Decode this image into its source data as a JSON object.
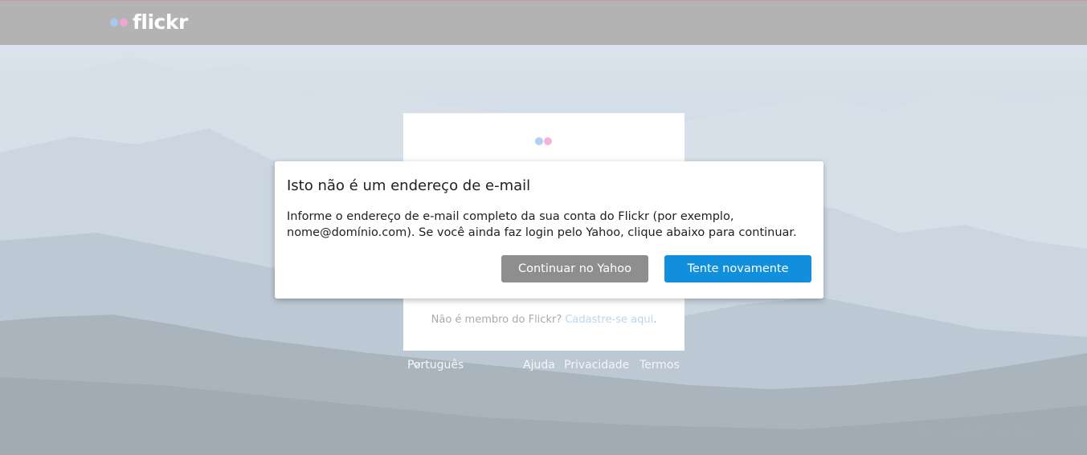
{
  "header": {
    "logo_text": "flickr",
    "logo_icon": "flickr-dots-icon"
  },
  "card": {
    "logo_icon": "flickr-dots-icon",
    "signup_prompt": "Não é membro do Flickr?",
    "signup_link": "Cadastre-se aqui",
    "signup_suffix": "."
  },
  "footer": {
    "language": "Português",
    "language_icon": "chevron-down-icon",
    "links": [
      "Ajuda",
      "Privacidade",
      "Termos"
    ]
  },
  "photo_credit": "033120190455 por Henry , CC BY",
  "dialog": {
    "title": "Isto não é um endereço de e-mail",
    "message": "Informe o endereço de e-mail completo da sua conta do Flickr (por exemplo, nome@domínio.com). Se você ainda faz login pelo Yahoo, clique abaixo para continuar.",
    "secondary_button": "Continuar no Yahoo",
    "primary_button": "Tente novamente"
  },
  "colors": {
    "header_bg": "#b3b3b3",
    "flickr_blue": "#a7c8f0",
    "flickr_pink": "#f0a6d0",
    "primary_button": "#128fdc",
    "secondary_button": "#8e8e8e"
  }
}
